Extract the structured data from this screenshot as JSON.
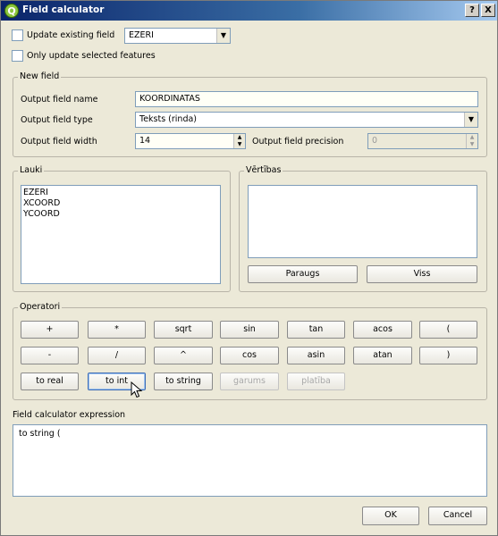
{
  "window": {
    "title": "Field calculator",
    "help_label": "?",
    "close_label": "X",
    "icon": "Q"
  },
  "top": {
    "update_existing_label": "Update existing field",
    "update_existing_checked": false,
    "update_field_value": "EZERI",
    "only_selected_label": "Only update selected features",
    "only_selected_checked": false
  },
  "new_field": {
    "group_label": "New field",
    "name_label": "Output field name",
    "name_value": "KOORDINATAS",
    "type_label": "Output field type",
    "type_value": "Teksts (rinda)",
    "width_label": "Output field width",
    "width_value": "14",
    "precision_label": "Output field precision",
    "precision_value": "0"
  },
  "lauki": {
    "group_label": "Lauki",
    "fields": [
      "EZERI",
      "XCOORD",
      "YCOORD"
    ]
  },
  "vertibas": {
    "group_label": "Vērtības",
    "sample_button": "Paraugs",
    "all_button": "Viss"
  },
  "operators": {
    "group_label": "Operatori",
    "row1": [
      "+",
      "*",
      "sqrt",
      "sin",
      "tan",
      "acos",
      "("
    ],
    "row2": [
      "-",
      "/",
      "^",
      "cos",
      "asin",
      "atan",
      ")"
    ],
    "row3": [
      "to real",
      "to int",
      "to string",
      "garums",
      "platība"
    ]
  },
  "expression": {
    "label": "Field calculator expression",
    "value": "to string ("
  },
  "footer": {
    "ok_label": "OK",
    "cancel_label": "Cancel"
  }
}
